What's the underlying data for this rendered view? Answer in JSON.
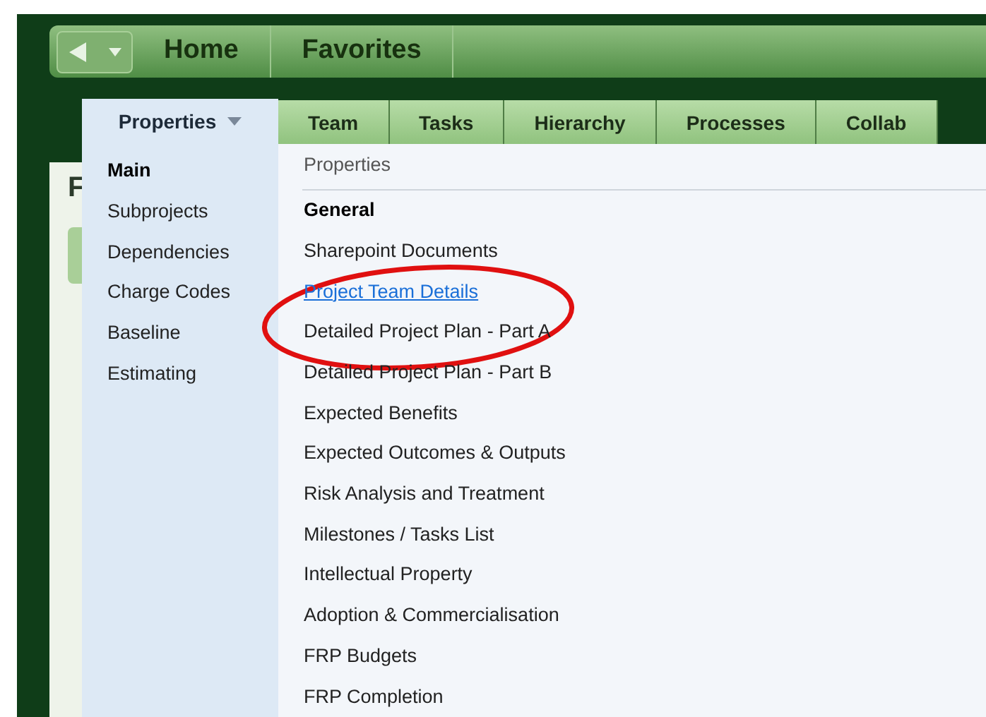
{
  "nav": {
    "back_button": true,
    "links": [
      "Home",
      "Favorites"
    ]
  },
  "page_title": "F",
  "tabs": [
    {
      "label": "Properties",
      "selected": true,
      "has_menu": true
    },
    {
      "label": "Team",
      "selected": false,
      "has_menu": false
    },
    {
      "label": "Tasks",
      "selected": false,
      "has_menu": false
    },
    {
      "label": "Hierarchy",
      "selected": false,
      "has_menu": false
    },
    {
      "label": "Processes",
      "selected": false,
      "has_menu": false
    },
    {
      "label": "Collab",
      "selected": false,
      "has_menu": false
    }
  ],
  "menu": {
    "sections": [
      {
        "label": "Main",
        "selected": true
      },
      {
        "label": "Subprojects",
        "selected": false
      },
      {
        "label": "Dependencies",
        "selected": false
      },
      {
        "label": "Charge Codes",
        "selected": false
      },
      {
        "label": "Baseline",
        "selected": false
      },
      {
        "label": "Estimating",
        "selected": false
      }
    ],
    "header": "Properties",
    "items": [
      {
        "label": "General",
        "kind": "heading",
        "selected": false
      },
      {
        "label": "Sharepoint Documents",
        "kind": "link",
        "selected": false
      },
      {
        "label": "Project Team Details",
        "kind": "link",
        "selected": true
      },
      {
        "label": "Detailed Project Plan - Part A",
        "kind": "link",
        "selected": false
      },
      {
        "label": "Detailed Project Plan - Part B",
        "kind": "link",
        "selected": false
      },
      {
        "label": "Expected Benefits",
        "kind": "link",
        "selected": false
      },
      {
        "label": "Expected Outcomes & Outputs",
        "kind": "link",
        "selected": false
      },
      {
        "label": "Risk Analysis and Treatment",
        "kind": "link",
        "selected": false
      },
      {
        "label": "Milestones / Tasks List",
        "kind": "link",
        "selected": false
      },
      {
        "label": "Intellectual Property",
        "kind": "link",
        "selected": false
      },
      {
        "label": "Adoption & Commercialisation",
        "kind": "link",
        "selected": false
      },
      {
        "label": "FRP Budgets",
        "kind": "link",
        "selected": false
      },
      {
        "label": "FRP Completion",
        "kind": "link",
        "selected": false
      }
    ]
  },
  "annotation": {
    "kind": "ellipse",
    "color": "#e01010"
  }
}
